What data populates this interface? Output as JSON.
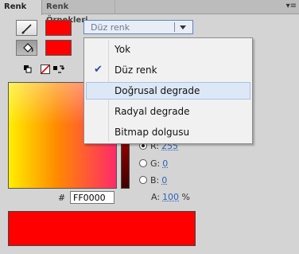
{
  "tabs": [
    {
      "label": "Renk",
      "active": true
    },
    {
      "label": "Renk Örnekleri",
      "active": false
    }
  ],
  "panel_menu_icon": "panel-menu-icon",
  "stroke_color": "#FF0000",
  "fill_color": "#FF0000",
  "fill_type": {
    "selected": "Düz renk",
    "options": [
      "Yok",
      "Düz renk",
      "Doğrusal degrade",
      "Radyal degrade",
      "Bitmap dolgusu"
    ],
    "checked_index": 1,
    "hovered_index": 2
  },
  "rgb": {
    "r": {
      "label": "R:",
      "value": "255"
    },
    "g": {
      "label": "G:",
      "value": "0"
    },
    "b": {
      "label": "B:",
      "value": "0"
    },
    "a": {
      "label": "A:",
      "value": "100",
      "unit": "%"
    }
  },
  "hex": {
    "hash": "#",
    "value": "FF0000"
  },
  "preview_color": "#FF0000"
}
